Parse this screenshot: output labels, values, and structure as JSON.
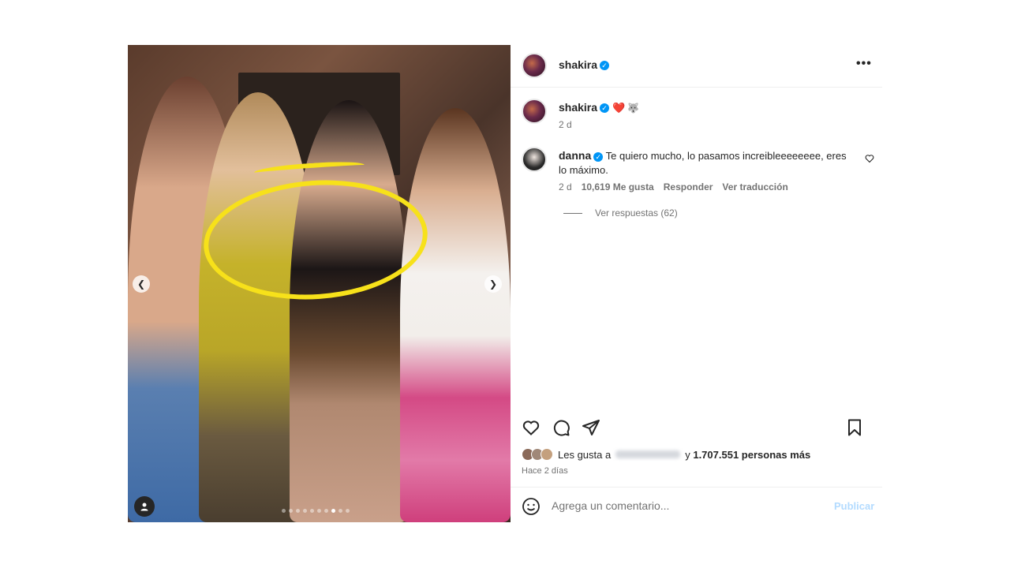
{
  "post": {
    "author": "shakira",
    "more_icon": "more-horizontal-icon",
    "caption": {
      "author": "shakira",
      "emoji_heart": "❤️",
      "emoji_wolf": "🐺",
      "time": "2 d"
    },
    "comment": {
      "author": "danna",
      "text": "Te quiero mucho, lo pasamos increibleeeeeeee, eres lo máximo.",
      "time": "2 d",
      "likes": "10,619 Me gusta",
      "reply_label": "Responder",
      "translate_label": "Ver traducción",
      "view_replies": "Ver respuestas (62)"
    },
    "likes_prefix": "Les gusta a",
    "likes_suffix": "y",
    "likes_count": "1.707.551 personas más",
    "time_ago": "Hace 2 días",
    "comment_placeholder": "Agrega un comentario...",
    "publish_label": "Publicar"
  },
  "carousel": {
    "total": 10,
    "active_index": 7
  },
  "colors": {
    "accent": "#0095f6",
    "highlight_circle": "#f7e11a",
    "publish_disabled": "#b3dbff"
  }
}
